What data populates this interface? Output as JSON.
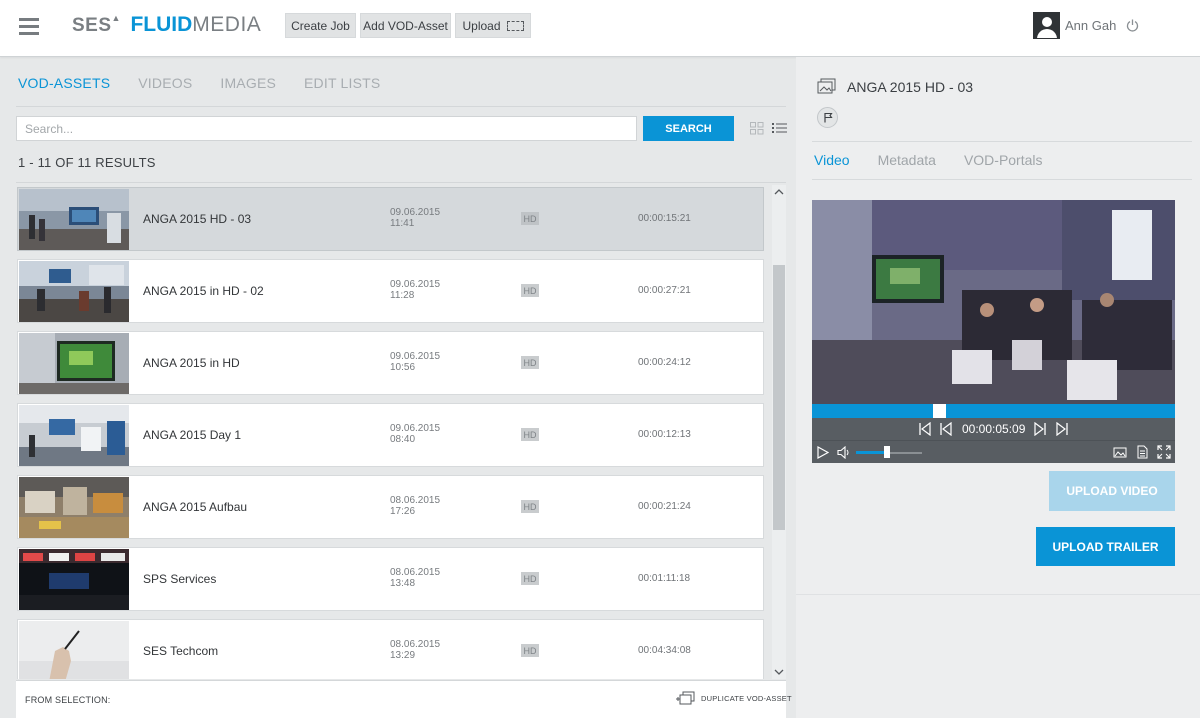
{
  "header": {
    "logo_primary": "SES",
    "logo_fluid": "FLUID",
    "logo_media": "MEDIA",
    "buttons": {
      "create_job": "Create Job",
      "add_vod_asset": "Add VOD-Asset",
      "upload": "Upload"
    },
    "user_name": "Ann Gah",
    "icons": [
      "menu-icon",
      "avatar-icon",
      "power-icon",
      "upload-area-icon"
    ]
  },
  "left": {
    "tabs": [
      {
        "label": "VOD-ASSETS",
        "active": true
      },
      {
        "label": "VIDEOS",
        "active": false
      },
      {
        "label": "IMAGES",
        "active": false
      },
      {
        "label": "EDIT LISTS",
        "active": false
      }
    ],
    "search": {
      "placeholder": "Search...",
      "value": "",
      "button": "SEARCH"
    },
    "results_text": "1 - 11 OF 11 RESULTS",
    "assets": [
      {
        "title": "ANGA 2015 HD - 03",
        "date": "09.06.2015",
        "time": "11:41",
        "quality": "HD",
        "duration": "00:00:15:21",
        "selected": true
      },
      {
        "title": "ANGA 2015 in HD - 02",
        "date": "09.06.2015",
        "time": "11:28",
        "quality": "HD",
        "duration": "00:00:27:21",
        "selected": false
      },
      {
        "title": "ANGA 2015 in HD",
        "date": "09.06.2015",
        "time": "10:56",
        "quality": "HD",
        "duration": "00:00:24:12",
        "selected": false
      },
      {
        "title": "ANGA 2015 Day 1",
        "date": "09.06.2015",
        "time": "08:40",
        "quality": "HD",
        "duration": "00:00:12:13",
        "selected": false
      },
      {
        "title": "ANGA 2015 Aufbau",
        "date": "08.06.2015",
        "time": "17:26",
        "quality": "HD",
        "duration": "00:00:21:24",
        "selected": false
      },
      {
        "title": "SPS Services",
        "date": "08.06.2015",
        "time": "13:48",
        "quality": "HD",
        "duration": "00:01:11:18",
        "selected": false
      },
      {
        "title": "SES Techcom",
        "date": "08.06.2015",
        "time": "13:29",
        "quality": "HD",
        "duration": "00:04:34:08",
        "selected": false
      }
    ],
    "footer": {
      "from_selection": "FROM SELECTION:",
      "duplicate_label": "DUPLICATE VOD-ASSET"
    }
  },
  "right": {
    "asset_title": "ANGA 2015 HD - 03",
    "tabs": [
      {
        "label": "Video",
        "active": true
      },
      {
        "label": "Metadata",
        "active": false
      },
      {
        "label": "VOD-Portals",
        "active": false
      }
    ],
    "player": {
      "timecode": "00:00:05:09",
      "progress_fraction": 0.35,
      "volume_fraction": 0.47
    },
    "upload_video": "UPLOAD VIDEO",
    "upload_trailer": "UPLOAD TRAILER"
  },
  "colors": {
    "accent": "#0a94d6",
    "accent_disabled": "#a9d5eb",
    "background": "#e6e8e9",
    "selected_row": "#d5d9dc"
  }
}
